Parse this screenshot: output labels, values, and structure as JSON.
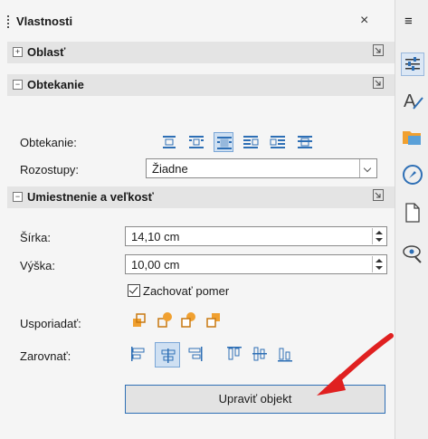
{
  "panel": {
    "title": "Vlastnosti",
    "close_symbol": "×",
    "menu_symbol": "≡"
  },
  "sections": {
    "area": {
      "label": "Oblasť",
      "toggle": "+"
    },
    "wrap": {
      "label": "Obtekanie",
      "toggle": "−"
    },
    "position": {
      "label": "Umiestnenie a veľkosť",
      "toggle": "−"
    }
  },
  "wrap": {
    "wrap_label": "Obtekanie:",
    "spacing_label": "Rozostupy:",
    "spacing_value": "Žiadne",
    "selected_index": 2
  },
  "position": {
    "width_label": "Šírka:",
    "width_value": "14,10 cm",
    "height_label": "Výška:",
    "height_value": "10,00 cm",
    "keep_ratio_label": "Zachovať pomer",
    "keep_ratio_checked": true,
    "arrange_label": "Usporiadať:",
    "align_label": "Zarovnať:",
    "align_selected_index": 1,
    "edit_button": "Upraviť objekt"
  },
  "colors": {
    "accent": "#2e6fb5",
    "arrow": "#e02020",
    "orange": "#f0a030"
  }
}
